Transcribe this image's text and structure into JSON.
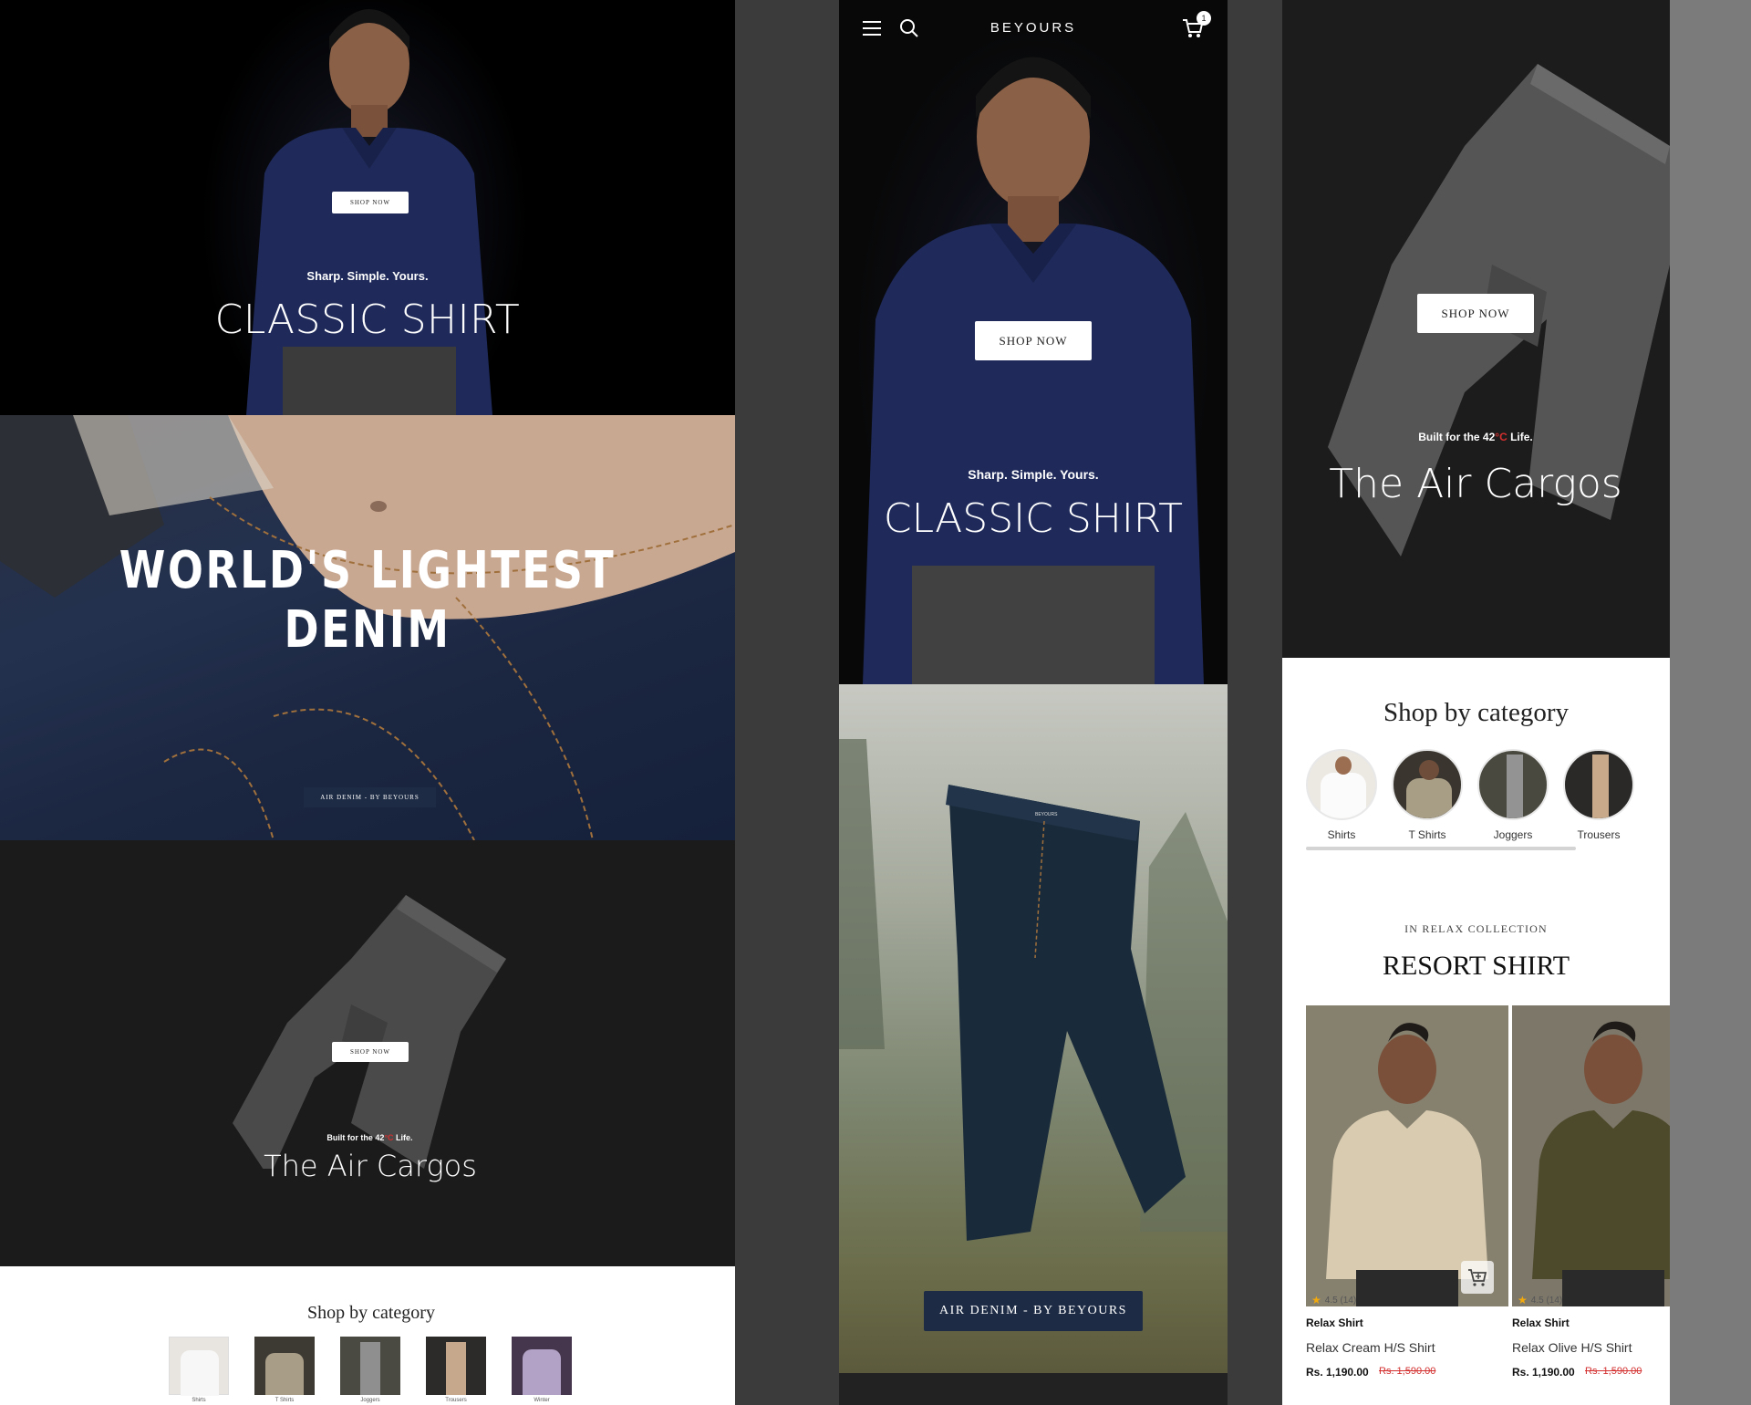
{
  "panelA": {
    "hero": {
      "button": "SHOP NOW",
      "tagline": "Sharp. Simple. Yours.",
      "title": "CLASSIC SHIRT"
    },
    "denim": {
      "headline": "WORLD'S LIGHTEST DENIM",
      "badge": "AIR DENIM - BY BEYOURS"
    },
    "cargo": {
      "button": "SHOP NOW",
      "tagline_prefix": "Built for the 42",
      "tagline_degree": "°C",
      "tagline_suffix": " Life.",
      "title": "The Air Cargos"
    },
    "category": {
      "heading": "Shop by category",
      "items": [
        "Shirts",
        "T Shirts",
        "Joggers",
        "Trousers",
        "Winter"
      ]
    }
  },
  "panelB": {
    "header": {
      "brand": "BEYOURS",
      "cart_count": "1"
    },
    "hero": {
      "button": "SHOP NOW",
      "tagline": "Sharp. Simple. Yours.",
      "title": "CLASSIC SHIRT"
    },
    "forest": {
      "jeans_label": "BEYOURS",
      "badge": "AIR DENIM - BY BEYOURS"
    }
  },
  "panelC": {
    "cargo": {
      "button": "SHOP NOW",
      "tagline_prefix": "Built for the 42",
      "tagline_degree": "°C",
      "tagline_suffix": " Life.",
      "title": "The Air Cargos"
    },
    "category": {
      "heading": "Shop by category",
      "items": [
        "Shirts",
        "T Shirts",
        "Joggers",
        "Trousers"
      ]
    },
    "collection": {
      "eyebrow": "IN RELAX COLLECTION",
      "title": "RESORT SHIRT"
    },
    "products": [
      {
        "rating": "4.5 (14)",
        "type": "Relax Shirt",
        "name": "Relax Cream H/S Shirt",
        "price": "Rs. 1,190.00",
        "old_price": "Rs. 1,590.00"
      },
      {
        "rating": "4.5 (14)",
        "type": "Relax Shirt",
        "name": "Relax Olive H/S Shirt",
        "price": "Rs. 1,190.00",
        "old_price": "Rs. 1,590.00"
      }
    ]
  },
  "colors": {
    "navy_shirt": "#1f2a5a",
    "denim": "#1d2a47",
    "badge_navy": "#1d2b44",
    "accent_red": "#d32f2f",
    "star": "#f2a90b"
  },
  "icons": [
    "menu-icon",
    "search-icon",
    "cart-icon",
    "add-to-cart-icon",
    "star-icon"
  ]
}
